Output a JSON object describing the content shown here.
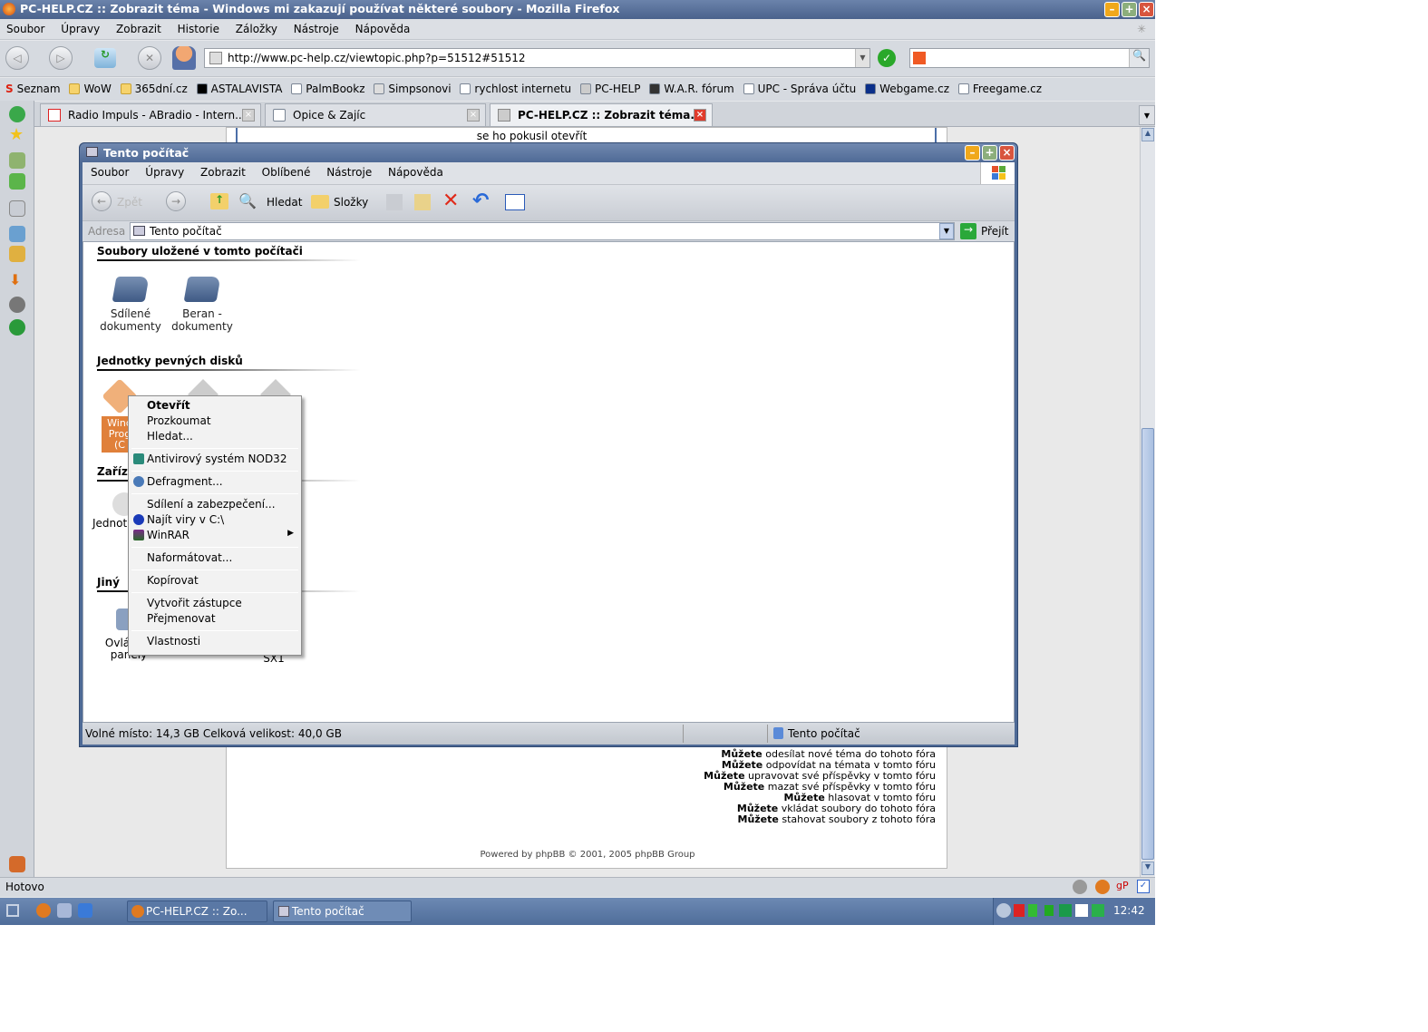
{
  "firefox": {
    "title": "PC-HELP.CZ :: Zobrazit téma - Windows mi zakazují používat některé soubory - Mozilla Firefox",
    "menu": [
      "Soubor",
      "Úpravy",
      "Zobrazit",
      "Historie",
      "Záložky",
      "Nástroje",
      "Nápověda"
    ],
    "url": "http://www.pc-help.cz/viewtopic.php?p=51512#51512",
    "search_value": "",
    "bookmarks": [
      "Seznam",
      "WoW",
      "365dní.cz",
      "ASTALAVISTA",
      "PalmBookz",
      "Simpsonovi",
      "rychlost internetu",
      "PC-HELP",
      "W.A.R. fórum",
      "UPC - Správa účtu",
      "Webgame.cz",
      "Freegame.cz"
    ],
    "tabs": [
      {
        "label": "Radio Impuls - ABradio - Intern..."
      },
      {
        "label": "Opice & Zajíc"
      },
      {
        "label": "PC-HELP.CZ :: Zobrazit téma...",
        "active": true
      }
    ],
    "status": "Hotovo"
  },
  "forum": {
    "top_text": "se ho pokusil otevřít",
    "perm_bold": "Můžete",
    "permissions": [
      "odesílat nové téma do tohoto fóra",
      "odpovídat na témata v tomto fóru",
      "upravovat své příspěvky v tomto fóru",
      "mazat své příspěvky v tomto fóru",
      "hlasovat v tomto fóru",
      "vkládat soubory do tohoto fóra",
      "stahovat soubory z tohoto fóra"
    ],
    "powered": "Powered by phpBB © 2001, 2005 phpBB Group"
  },
  "explorer": {
    "title": "Tento počítač",
    "menu": [
      "Soubor",
      "Úpravy",
      "Zobrazit",
      "Oblíbené",
      "Nástroje",
      "Nápověda"
    ],
    "toolbar": {
      "back": "Zpět",
      "search": "Hledat",
      "folders": "Složky"
    },
    "address_label": "Adresa",
    "address_value": "Tento počítač",
    "go": "Přejít",
    "groups": [
      {
        "title": "Soubory uložené v tomto počítači",
        "items": [
          "Sdílené dokumenty",
          "Beran - dokumenty"
        ]
      },
      {
        "title": "Jednotky pevných disků",
        "items": [
          "Windows Programy (C:)"
        ]
      },
      {
        "title": "Zařízení",
        "items": [
          "Jednotka DVD-RW"
        ]
      },
      {
        "title": "Jiný",
        "items": [
          "Ovládací panely",
          "SX1"
        ]
      }
    ],
    "selected_partial": [
      "Wind",
      "Prog",
      "(C"
    ],
    "status_left": "Volné místo: 14,3 GB Celková velikost: 40,0 GB",
    "status_right": "Tento počítač"
  },
  "context_menu": {
    "items": [
      "Otevřít",
      "Prozkoumat",
      "Hledat...",
      "Antivirový systém NOD32",
      "Defragment...",
      "Sdílení a zabezpečení...",
      "Najít viry v C:\\",
      "WinRAR",
      "Naformátovat...",
      "Kopírovat",
      "Vytvořit zástupce",
      "Přejmenovat",
      "Vlastnosti"
    ]
  },
  "taskbar": {
    "buttons": [
      "PC-HELP.CZ :: Zo...",
      "Tento počítač"
    ],
    "clock": "12:42"
  },
  "colors": {
    "titlebar": "#4f6a96",
    "taskbar": "#5c7aa6",
    "selection": "#e0803a",
    "close": "#e13b2b"
  }
}
